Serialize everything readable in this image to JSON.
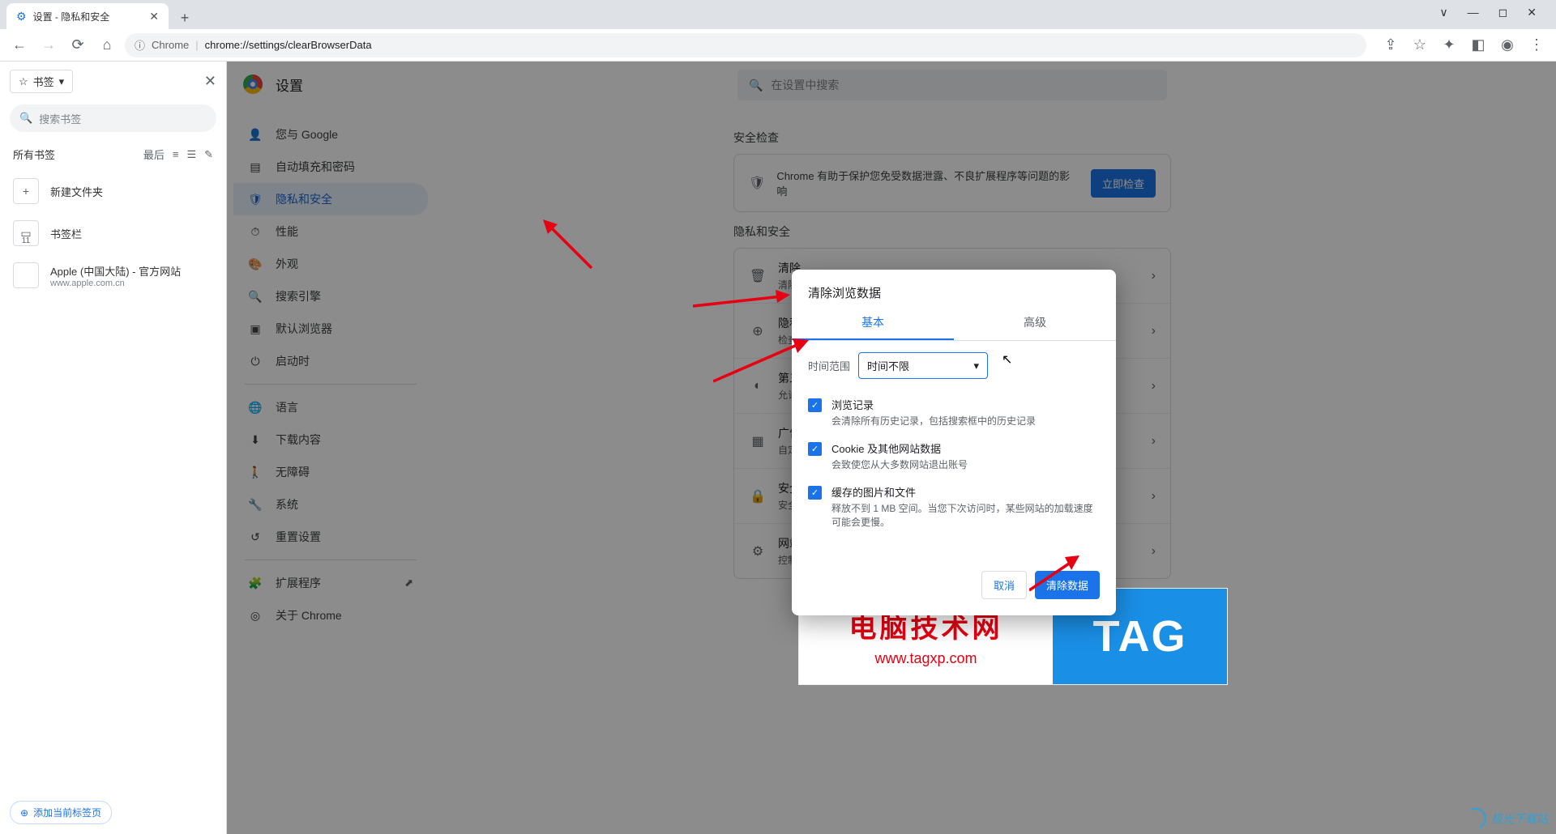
{
  "window": {
    "tab_title": "设置 - 隐私和安全"
  },
  "addressbar": {
    "host_label": "Chrome",
    "url": "chrome://settings/clearBrowserData"
  },
  "bookmarks_panel": {
    "dropdown_label": "书签",
    "search_placeholder": "搜索书签",
    "all_label": "所有书签",
    "sort_label": "最后",
    "new_folder": "新建文件夹",
    "bar_label": "书签栏",
    "bar_count": "11",
    "apple_title": "Apple (中国大陆) - 官方网站",
    "apple_url": "www.apple.com.cn",
    "add_current": "添加当前标签页"
  },
  "settings": {
    "title": "设置",
    "search_placeholder": "在设置中搜索",
    "nav": {
      "you_google": "您与 Google",
      "autofill": "自动填充和密码",
      "privacy": "隐私和安全",
      "performance": "性能",
      "appearance": "外观",
      "search_engine": "搜索引擎",
      "default_browser": "默认浏览器",
      "on_startup": "启动时",
      "languages": "语言",
      "downloads": "下载内容",
      "accessibility": "无障碍",
      "system": "系统",
      "reset": "重置设置",
      "extensions": "扩展程序",
      "about": "关于 Chrome"
    },
    "safety_check_heading": "安全检查",
    "safety_text": "Chrome 有助于保护您免受数据泄露、不良扩展程序等问题的影响",
    "safety_button": "立即检查",
    "privacy_heading": "隐私和安全",
    "rows": {
      "clear_t": "清除",
      "clear_s": "清除",
      "priv_t": "隐私",
      "priv_s": "检查",
      "third_t": "第三",
      "third_s": "允许",
      "ads_t": "广告",
      "ads_s": "自定",
      "safe_t": "安全",
      "safe_s": "安全",
      "site_t": "网站",
      "site_s": "控制"
    }
  },
  "dialog": {
    "title": "清除浏览数据",
    "tab_basic": "基本",
    "tab_advanced": "高级",
    "time_label": "时间范围",
    "time_value": "时间不限",
    "history_t": "浏览记录",
    "history_s": "会清除所有历史记录，包括搜索框中的历史记录",
    "cookies_t": "Cookie 及其他网站数据",
    "cookies_s": "会致使您从大多数网站退出账号",
    "cache_t": "缓存的图片和文件",
    "cache_s": "释放不到 1 MB 空间。当您下次访问时，某些网站的加载速度可能会更慢。",
    "cancel": "取消",
    "confirm": "清除数据"
  },
  "watermark": {
    "cn": "电脑技术网",
    "url": "www.tagxp.com",
    "tag": "TAG"
  },
  "corner": "极光下载站"
}
